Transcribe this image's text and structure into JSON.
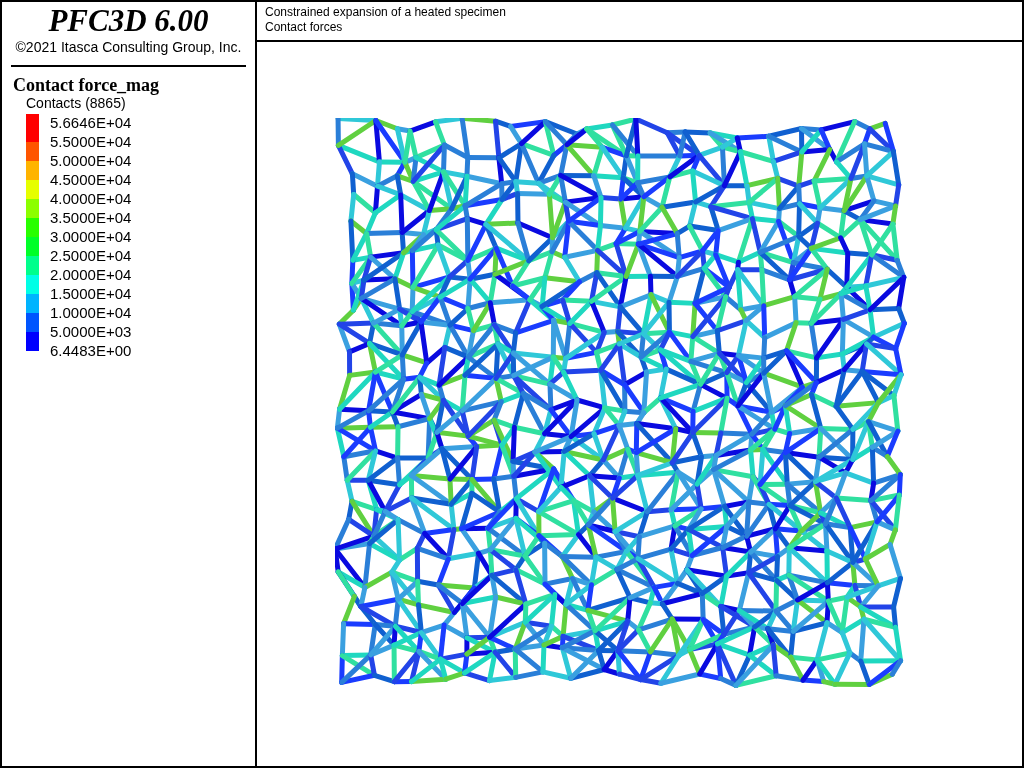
{
  "product": {
    "title": "PFC3D 6.00",
    "copyright": "©2021 Itasca Consulting Group, Inc."
  },
  "legend": {
    "title": "Contact force_mag",
    "subtitle": "Contacts (8865)",
    "labels": [
      "5.6646E+04",
      "5.5000E+04",
      "5.0000E+04",
      "4.5000E+04",
      "4.0000E+04",
      "3.5000E+04",
      "3.0000E+04",
      "2.5000E+04",
      "2.0000E+04",
      "1.5000E+04",
      "1.0000E+04",
      "5.0000E+03",
      "6.4483E+00"
    ],
    "bands": [
      {
        "color": "#ff0000"
      },
      {
        "color": "#ff5500"
      },
      {
        "color": "#ffb400"
      },
      {
        "color": "#e6ff00"
      },
      {
        "color": "#8cff00"
      },
      {
        "color": "#28ff00"
      },
      {
        "color": "#00ff28"
      },
      {
        "color": "#00ff8c"
      },
      {
        "color": "#00ffe6"
      },
      {
        "color": "#00b4ff"
      },
      {
        "color": "#0055ff"
      },
      {
        "color": "#0000ff"
      }
    ]
  },
  "plot": {
    "title_lines": [
      "Constrained expansion of a heated specimen",
      "Contact forces"
    ]
  }
}
